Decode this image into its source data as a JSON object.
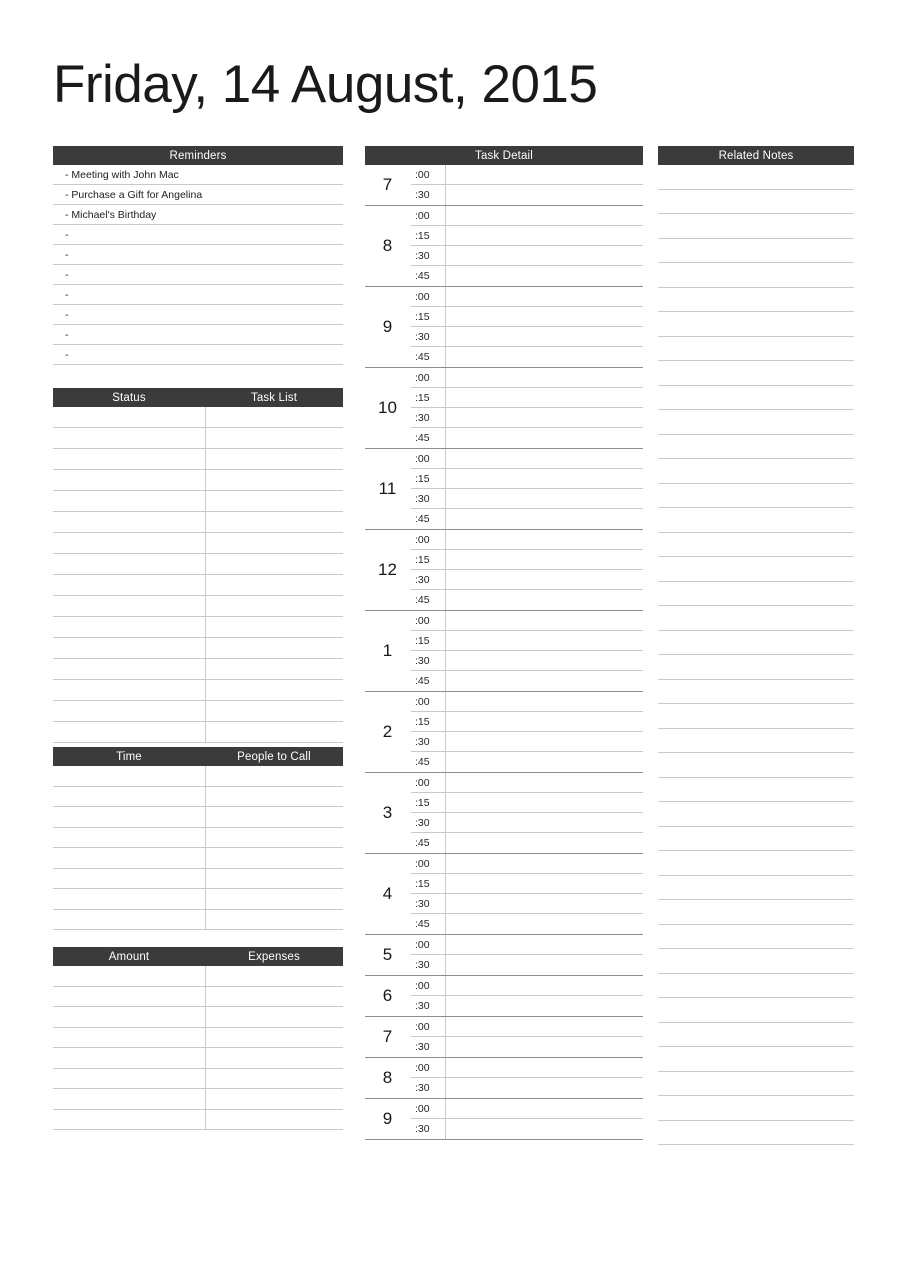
{
  "document": {
    "title": "Friday, 14 August, 2015"
  },
  "theme": {
    "header_bg": "#3b3b3b",
    "header_text": "#ffffff",
    "rule_color": "#c9c9c9",
    "hour_rule_color": "#8d8d8d",
    "page_bg": "#ffffff",
    "body_text": "#1d1d1d"
  },
  "reminders": {
    "header": "Reminders",
    "items": [
      "- Meeting with John Mac",
      "- Purchase a Gift for Angelina",
      "- Michael's Birthday",
      "-",
      "-",
      "-",
      "-",
      "-",
      "-",
      "-"
    ]
  },
  "task_list": {
    "header_left": "Status",
    "header_right": "Task List",
    "rows": [
      {
        "status": "",
        "task": ""
      },
      {
        "status": "",
        "task": ""
      },
      {
        "status": "",
        "task": ""
      },
      {
        "status": "",
        "task": ""
      },
      {
        "status": "",
        "task": ""
      },
      {
        "status": "",
        "task": ""
      },
      {
        "status": "",
        "task": ""
      },
      {
        "status": "",
        "task": ""
      },
      {
        "status": "",
        "task": ""
      },
      {
        "status": "",
        "task": ""
      },
      {
        "status": "",
        "task": ""
      },
      {
        "status": "",
        "task": ""
      },
      {
        "status": "",
        "task": ""
      },
      {
        "status": "",
        "task": ""
      },
      {
        "status": "",
        "task": ""
      },
      {
        "status": "",
        "task": ""
      }
    ]
  },
  "people_to_call": {
    "header_left": "Time",
    "header_right": "People to Call",
    "rows": [
      {
        "time": "",
        "person": ""
      },
      {
        "time": "",
        "person": ""
      },
      {
        "time": "",
        "person": ""
      },
      {
        "time": "",
        "person": ""
      },
      {
        "time": "",
        "person": ""
      },
      {
        "time": "",
        "person": ""
      },
      {
        "time": "",
        "person": ""
      },
      {
        "time": "",
        "person": ""
      }
    ]
  },
  "expenses": {
    "header_left": "Amount",
    "header_right": "Expenses",
    "rows": [
      {
        "amount": "",
        "expense": ""
      },
      {
        "amount": "",
        "expense": ""
      },
      {
        "amount": "",
        "expense": ""
      },
      {
        "amount": "",
        "expense": ""
      },
      {
        "amount": "",
        "expense": ""
      },
      {
        "amount": "",
        "expense": ""
      },
      {
        "amount": "",
        "expense": ""
      },
      {
        "amount": "",
        "expense": ""
      }
    ]
  },
  "task_detail": {
    "header": "Task Detail",
    "hours": [
      {
        "hour": "7",
        "slots": [
          {
            "min": ":00",
            "text": ""
          },
          {
            "min": ":30",
            "text": ""
          }
        ]
      },
      {
        "hour": "8",
        "slots": [
          {
            "min": ":00",
            "text": ""
          },
          {
            "min": ":15",
            "text": ""
          },
          {
            "min": ":30",
            "text": ""
          },
          {
            "min": ":45",
            "text": ""
          }
        ]
      },
      {
        "hour": "9",
        "slots": [
          {
            "min": ":00",
            "text": ""
          },
          {
            "min": ":15",
            "text": ""
          },
          {
            "min": ":30",
            "text": ""
          },
          {
            "min": ":45",
            "text": ""
          }
        ]
      },
      {
        "hour": "10",
        "slots": [
          {
            "min": ":00",
            "text": ""
          },
          {
            "min": ":15",
            "text": ""
          },
          {
            "min": ":30",
            "text": ""
          },
          {
            "min": ":45",
            "text": ""
          }
        ]
      },
      {
        "hour": "11",
        "slots": [
          {
            "min": ":00",
            "text": ""
          },
          {
            "min": ":15",
            "text": ""
          },
          {
            "min": ":30",
            "text": ""
          },
          {
            "min": ":45",
            "text": ""
          }
        ]
      },
      {
        "hour": "12",
        "slots": [
          {
            "min": ":00",
            "text": ""
          },
          {
            "min": ":15",
            "text": ""
          },
          {
            "min": ":30",
            "text": ""
          },
          {
            "min": ":45",
            "text": ""
          }
        ]
      },
      {
        "hour": "1",
        "slots": [
          {
            "min": ":00",
            "text": ""
          },
          {
            "min": ":15",
            "text": ""
          },
          {
            "min": ":30",
            "text": ""
          },
          {
            "min": ":45",
            "text": ""
          }
        ]
      },
      {
        "hour": "2",
        "slots": [
          {
            "min": ":00",
            "text": ""
          },
          {
            "min": ":15",
            "text": ""
          },
          {
            "min": ":30",
            "text": ""
          },
          {
            "min": ":45",
            "text": ""
          }
        ]
      },
      {
        "hour": "3",
        "slots": [
          {
            "min": ":00",
            "text": ""
          },
          {
            "min": ":15",
            "text": ""
          },
          {
            "min": ":30",
            "text": ""
          },
          {
            "min": ":45",
            "text": ""
          }
        ]
      },
      {
        "hour": "4",
        "slots": [
          {
            "min": ":00",
            "text": ""
          },
          {
            "min": ":15",
            "text": ""
          },
          {
            "min": ":30",
            "text": ""
          },
          {
            "min": ":45",
            "text": ""
          }
        ]
      },
      {
        "hour": "5",
        "slots": [
          {
            "min": ":00",
            "text": ""
          },
          {
            "min": ":30",
            "text": ""
          }
        ]
      },
      {
        "hour": "6",
        "slots": [
          {
            "min": ":00",
            "text": ""
          },
          {
            "min": ":30",
            "text": ""
          }
        ]
      },
      {
        "hour": "7",
        "slots": [
          {
            "min": ":00",
            "text": ""
          },
          {
            "min": ":30",
            "text": ""
          }
        ]
      },
      {
        "hour": "8",
        "slots": [
          {
            "min": ":00",
            "text": ""
          },
          {
            "min": ":30",
            "text": ""
          }
        ]
      },
      {
        "hour": "9",
        "slots": [
          {
            "min": ":00",
            "text": ""
          },
          {
            "min": ":30",
            "text": ""
          }
        ]
      }
    ]
  },
  "related_notes": {
    "header": "Related Notes",
    "lines": [
      "",
      "",
      "",
      "",
      "",
      "",
      "",
      "",
      "",
      "",
      "",
      "",
      "",
      "",
      "",
      "",
      "",
      "",
      "",
      "",
      "",
      "",
      "",
      "",
      "",
      "",
      "",
      "",
      "",
      "",
      "",
      "",
      "",
      "",
      "",
      "",
      "",
      "",
      "",
      ""
    ]
  }
}
